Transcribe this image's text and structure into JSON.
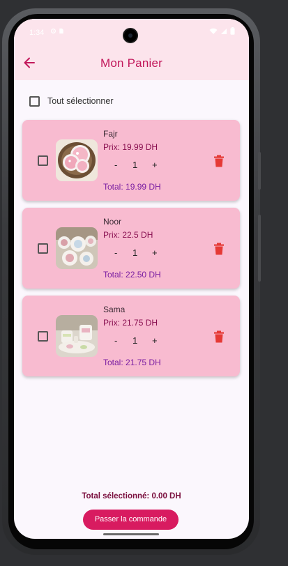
{
  "status_bar": {
    "time": "1:34",
    "left_icons": [
      "settings-icon",
      "sd-card-icon"
    ],
    "right_icons": [
      "wifi-icon",
      "signal-icon",
      "battery-icon"
    ]
  },
  "app_bar": {
    "title": "Mon Panier",
    "back_icon": "arrow-back-icon"
  },
  "select_all": {
    "label": "Tout sélectionner",
    "checked": false
  },
  "cart_items": [
    {
      "name": "Fajr",
      "price": "Prix: 19.99 DH",
      "quantity": "1",
      "minus": "-",
      "plus": "+",
      "total": "Total: 19.99 DH",
      "checked": false
    },
    {
      "name": "Noor",
      "price": "Prix: 22.5 DH",
      "quantity": "1",
      "minus": "-",
      "plus": "+",
      "total": "Total: 22.50 DH",
      "checked": false
    },
    {
      "name": "Sama",
      "price": "Prix: 21.75 DH",
      "quantity": "1",
      "minus": "-",
      "plus": "+",
      "total": "Total: 21.75 DH",
      "checked": false
    }
  ],
  "footer": {
    "selected_total": "Total sélectionné: 0.00 DH",
    "checkout_label": "Passer la commande"
  },
  "colors": {
    "primary": "#d81b60",
    "title": "#c2185b",
    "app_bar_bg": "#fce4ec",
    "card_bg": "#f8bbd0",
    "delete": "#e53935",
    "screen_bg": "#fbf7fd"
  }
}
